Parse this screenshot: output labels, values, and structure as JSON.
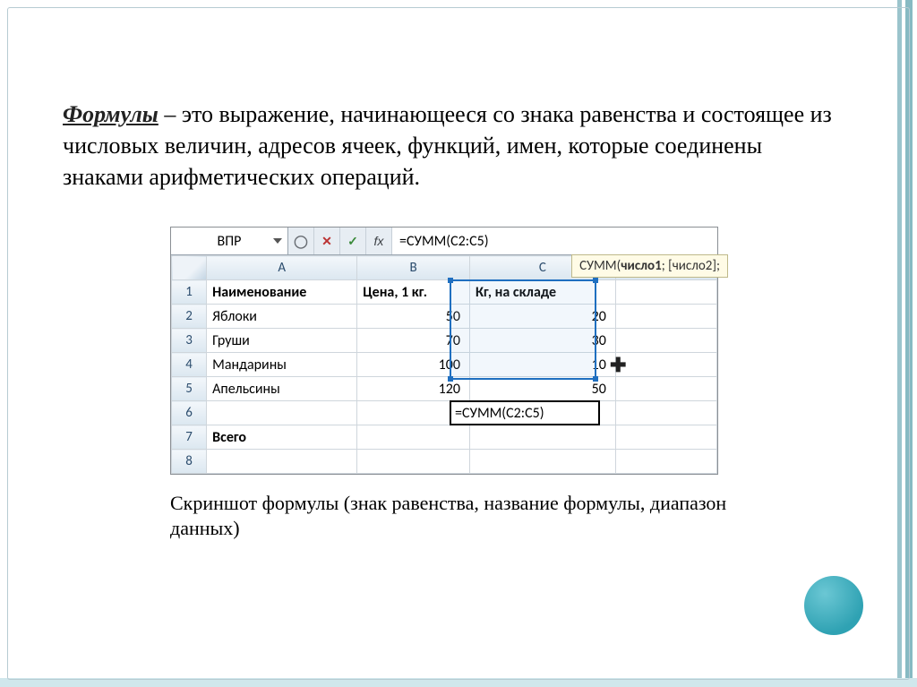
{
  "definition": {
    "term": "Формулы",
    "rest": " – это выражение, начинающееся со знака равенства и состоящее из числовых величин, адресов ячеек, функций, имен, которые соединены знаками арифметических операций."
  },
  "caption": "Скриншот формулы (знак равенства, название формулы, диапазон данных)",
  "excel": {
    "namebox": "ВПР",
    "formula": "=СУММ(C2:C5)",
    "tooltip_fn": "СУММ",
    "tooltip_args_bold": "число1",
    "tooltip_args_rest": "; [число2];",
    "columns": [
      "A",
      "B",
      "C"
    ],
    "rows": [
      "1",
      "2",
      "3",
      "4",
      "5",
      "6",
      "7",
      "8"
    ],
    "header": {
      "a": "Наименование",
      "b": "Цена, 1 кг.",
      "c": "Кг, на складе"
    },
    "data": [
      {
        "name": "Яблоки",
        "price": "50",
        "qty": "20"
      },
      {
        "name": "Груши",
        "price": "70",
        "qty": "30"
      },
      {
        "name": "Мандарины",
        "price": "100",
        "qty": "10"
      },
      {
        "name": "Апельсины",
        "price": "120",
        "qty": "50"
      }
    ],
    "total_label": "Всего",
    "active_cell_value": "=СУММ(C2:C5)"
  }
}
